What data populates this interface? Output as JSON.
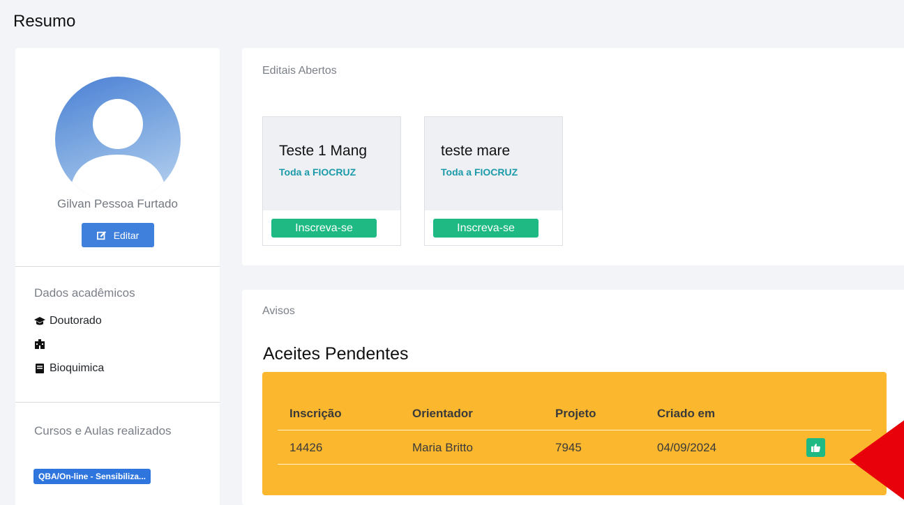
{
  "page": {
    "title": "Resumo"
  },
  "profile": {
    "name": "Gilvan Pessoa Furtado",
    "edit_label": "Editar",
    "academic_title": "Dados acadêmicos",
    "academic_items": [
      {
        "icon": "graduation-cap-icon",
        "label": "Doutorado"
      },
      {
        "icon": "building-icon",
        "label": ""
      },
      {
        "icon": "book-icon",
        "label": "Bioquimica"
      }
    ],
    "courses_title": "Cursos e Aulas realizados",
    "courses": [
      "QBA/On-line - Sensibiliza..."
    ]
  },
  "editais": {
    "title": "Editais Abertos",
    "items": [
      {
        "name": "Teste 1 Mang",
        "scope": "Toda a FIOCRUZ",
        "button": "Inscreva-se"
      },
      {
        "name": "teste mare",
        "scope": "Toda a FIOCRUZ",
        "button": "Inscreva-se"
      }
    ]
  },
  "avisos": {
    "title": "Avisos",
    "heading": "Aceites Pendentes",
    "columns": [
      "Inscrição",
      "Orientador",
      "Projeto",
      "Criado em"
    ],
    "rows": [
      {
        "inscricao": "14426",
        "orientador": "Maria Britto",
        "projeto": "7945",
        "criado_em": "04/09/2024",
        "action_icon": "thumbs-up-icon"
      }
    ]
  },
  "colors": {
    "primary": "#3f80dd",
    "success": "#1fba83",
    "warning": "#fbb72e",
    "info_text": "#1b9aaa",
    "arrow": "#e8000b"
  }
}
